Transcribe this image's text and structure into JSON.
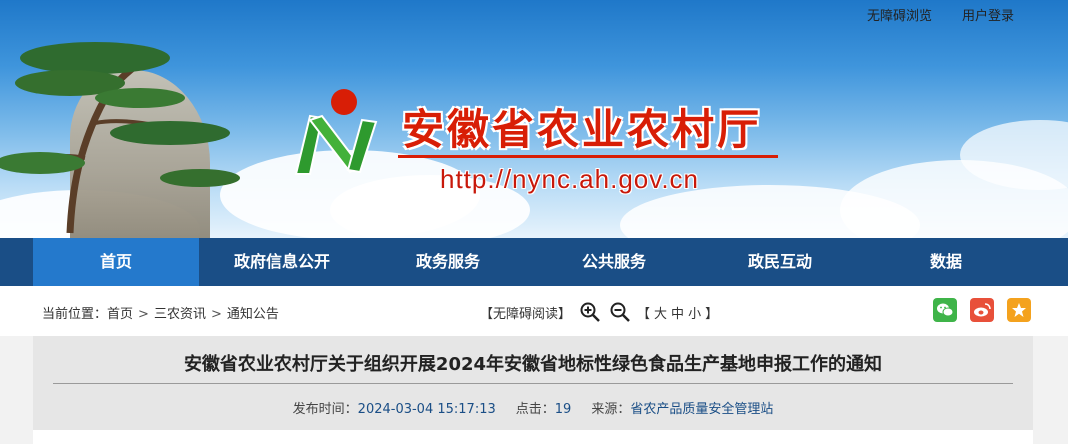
{
  "header": {
    "accessibility_link": "无障碍浏览",
    "login_link": "用户登录",
    "site_title": "安徽省农业农村厅",
    "site_url": "http://nync.ah.gov.cn"
  },
  "nav": {
    "items": [
      {
        "label": "首页"
      },
      {
        "label": "政府信息公开"
      },
      {
        "label": "政务服务"
      },
      {
        "label": "公共服务"
      },
      {
        "label": "政民互动"
      },
      {
        "label": "数据"
      }
    ],
    "active_index": 0
  },
  "breadcrumb": {
    "prefix": "当前位置：",
    "items": [
      "首页",
      "三农资讯",
      "通知公告"
    ],
    "separator": ">"
  },
  "reading_tools": {
    "accessible_read": "【无障碍阅读】",
    "font_size_open": "【",
    "font_size_large": "大",
    "font_size_medium": "中",
    "font_size_small": "小",
    "font_size_close": "】"
  },
  "share": {
    "icons": [
      "wechat-icon",
      "weibo-icon",
      "favorite-star-icon"
    ],
    "colors": {
      "wechat": "#3fb449",
      "weibo": "#e8503a",
      "favorite": "#f4a21e"
    }
  },
  "article": {
    "title": "安徽省农业农村厅关于组织开展2024年安徽省地标性绿色食品生产基地申报工作的通知",
    "publish_label": "发布时间：",
    "publish_time": "2024-03-04 15:17:13",
    "clicks_label": "点击：",
    "clicks": "19",
    "source_label": "来源：",
    "source": "省农产品质量安全管理站"
  },
  "colors": {
    "nav_bg": "#1a4e86",
    "nav_active": "#2479cc",
    "title_red": "#d81e06",
    "link_blue": "#1a4e86"
  }
}
